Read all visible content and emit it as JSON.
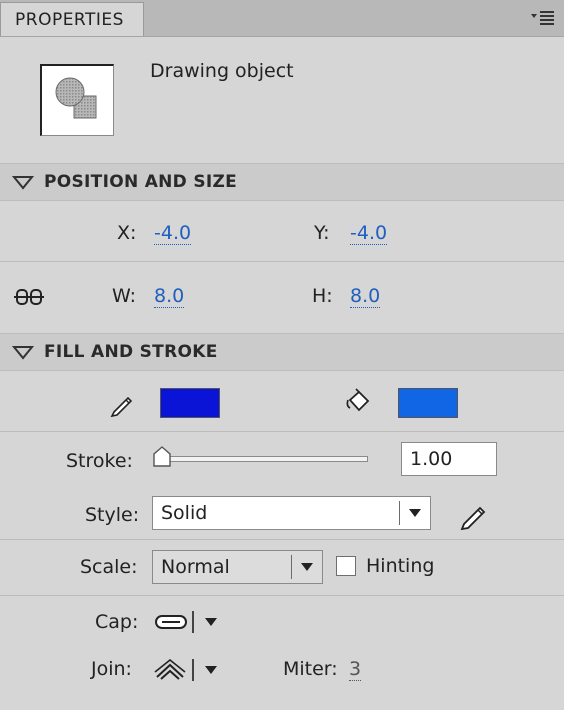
{
  "panel": {
    "tab_label": "PROPERTIES"
  },
  "object": {
    "label": "Drawing object"
  },
  "position_size": {
    "title": "POSITION AND SIZE",
    "x_label": "X:",
    "x_value": "-4.0",
    "y_label": "Y:",
    "y_value": "-4.0",
    "w_label": "W:",
    "w_value": "8.0",
    "h_label": "H:",
    "h_value": "8.0"
  },
  "fill_stroke": {
    "title": "FILL AND STROKE",
    "stroke_color": "#0a14d6",
    "fill_color": "#1166e6",
    "stroke_label": "Stroke:",
    "stroke_value": "1.00",
    "stroke_slider_fraction": 0.0,
    "style_label": "Style:",
    "style_value": "Solid",
    "scale_label": "Scale:",
    "scale_value": "Normal",
    "hinting_label": "Hinting",
    "hinting_checked": false,
    "cap_label": "Cap:",
    "join_label": "Join:",
    "miter_label": "Miter:",
    "miter_value": "3"
  },
  "icons": {
    "panel_menu": "panel-menu-icon",
    "thumbnail": "drawing-object-icon",
    "collapse": "collapse-triangle-icon",
    "link": "link-constrain-icon",
    "stroke_pencil": "pencil-icon",
    "fill_bucket": "paint-bucket-icon",
    "edit_style": "edit-stroke-style-icon",
    "cap": "cap-round-icon",
    "join": "join-round-icon"
  }
}
